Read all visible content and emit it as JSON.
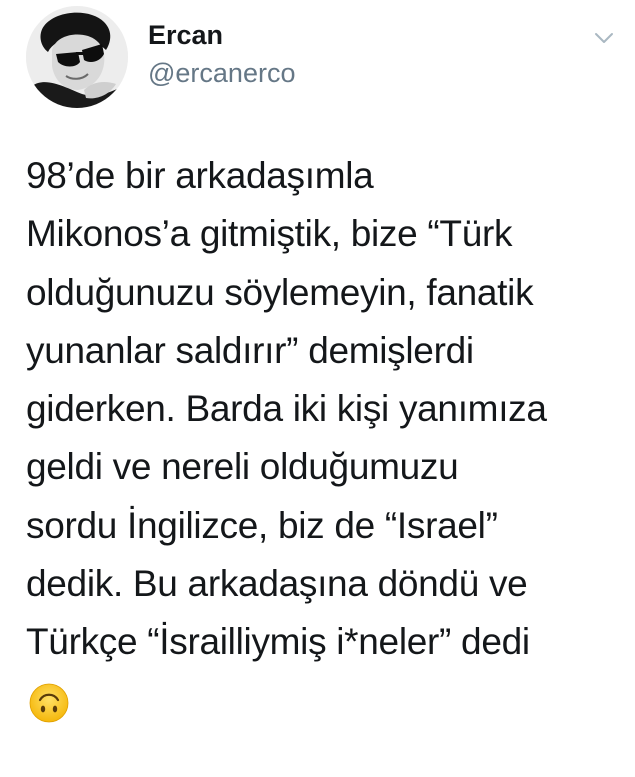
{
  "author": {
    "display_name": "Ercan",
    "handle": "@ercanerco",
    "avatar_icon": "profile-photo-man-sunglasses"
  },
  "header": {
    "menu_icon": "chevron-down-icon"
  },
  "tweet": {
    "lines": [
      "98’de bir arkadaşımla",
      "Mikonos’a gitmiştik, bize “Türk",
      "olduğunuzu söylemeyin, fanatik",
      "yunanlar saldırır” demişlerdi",
      "giderken. Barda iki kişi yanımıza",
      "geldi ve nereli olduğumuzu",
      "sordu İngilizce, biz de “Israel”",
      "dedik. Bu arkadaşına döndü ve",
      "Türkçe “İsrailliymiş i*neler” dedi"
    ],
    "emoji": "upside-down-face-emoji"
  },
  "colors": {
    "text": "#14171a",
    "secondary_text": "#657786",
    "chevron": "#aab8c2",
    "emoji_yellow": "#ffcc33"
  }
}
